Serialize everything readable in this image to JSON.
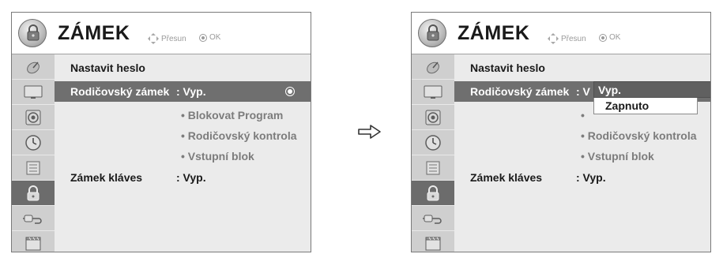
{
  "left_panel": {
    "title": "ZÁMEK",
    "hint_move": "Přesun",
    "hint_ok": "OK",
    "rows": {
      "password_label": "Nastavit heslo",
      "parental_label": "Rodičovský zámek",
      "parental_value": ": Vyp.",
      "sub_block_program": "• Blokovat Program",
      "sub_parental_control": "• Rodičovský kontrola",
      "sub_input_block": "• Vstupní blok",
      "key_lock_label": "Zámek kláves",
      "key_lock_value": ": Vyp."
    }
  },
  "right_panel": {
    "title": "ZÁMEK",
    "hint_move": "Přesun",
    "hint_ok": "OK",
    "rows": {
      "password_label": "Nastavit heslo",
      "parental_label": "Rodičovský zámek",
      "parental_value_partial": ": V",
      "sub_parental_control": "• Rodičovský kontrola",
      "sub_input_block": "• Vstupní blok",
      "sub_bullet_partial": "•",
      "key_lock_label": "Zámek kláves",
      "key_lock_value": ": Vyp."
    },
    "dropdown": {
      "selected": "Vyp.",
      "other": "Zapnuto"
    }
  },
  "sidebar_icons": [
    "satellite-icon",
    "screen-icon",
    "speaker-icon",
    "clock-icon",
    "option-icon",
    "lock-icon",
    "input-icon",
    "media-icon"
  ],
  "active_sidebar_icon": "lock-icon",
  "colors": {
    "sidebar": "#cfcfcf",
    "sidebar_active": "#6c6c6c",
    "content": "#ebebeb",
    "highlight_row": "#6f6f6f",
    "sub_text": "#7c7c7c"
  }
}
